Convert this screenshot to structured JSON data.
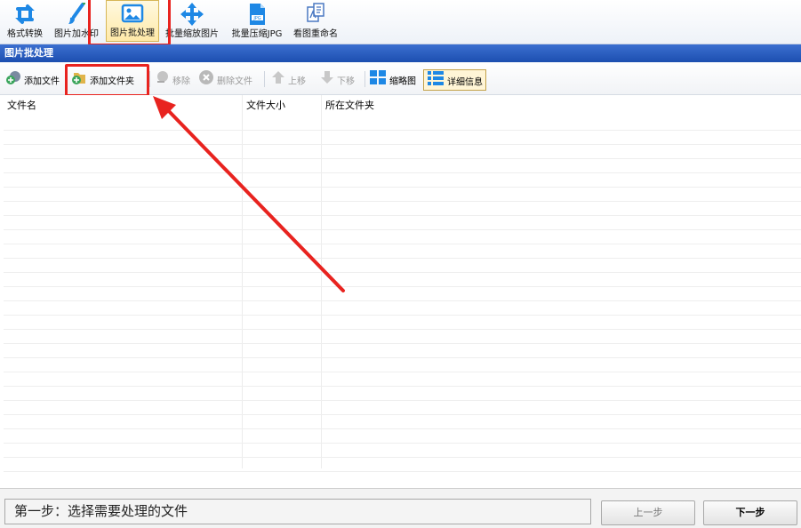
{
  "topbar": {
    "tools": [
      {
        "label": "格式转换",
        "icon": "convert-icon"
      },
      {
        "label": "图片加水印",
        "icon": "brush-icon"
      },
      {
        "label": "图片批处理",
        "icon": "image-icon",
        "active": true
      },
      {
        "label": "批量缩放图片",
        "icon": "move-arrows-icon"
      },
      {
        "label": "批量压缩JPG",
        "icon": "jpg-file-icon"
      },
      {
        "label": "看图重命名",
        "icon": "rename-icon"
      }
    ]
  },
  "panel": {
    "title": "图片批处理"
  },
  "toolbar": {
    "add_file": "添加文件",
    "add_folder": "添加文件夹",
    "remove": "移除",
    "delete_file": "删除文件",
    "move_up": "上移",
    "move_down": "下移",
    "thumbnail": "缩略图",
    "details": "详细信息"
  },
  "list": {
    "columns": [
      "文件名",
      "文件大小",
      "所在文件夹"
    ],
    "rows": []
  },
  "footer": {
    "status": "第一步：选择需要处理的文件",
    "prev_button": "上一步",
    "next_button": "下一步"
  },
  "colors": {
    "title_bar": "#1d4fb0",
    "highlight": "#e8231f",
    "icon_blue": "#1e88e5"
  }
}
